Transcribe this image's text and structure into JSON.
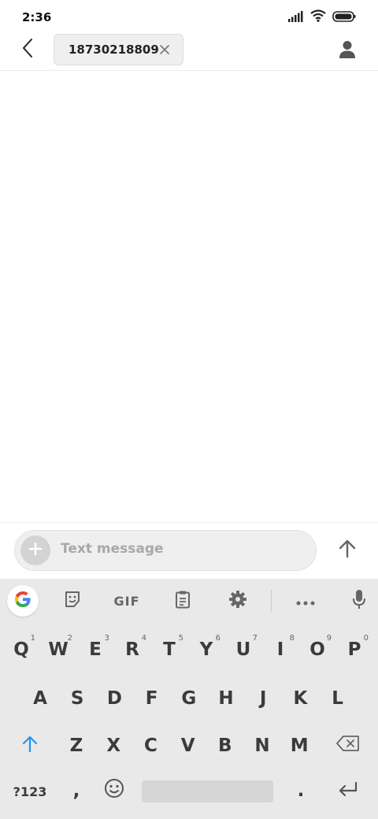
{
  "status_bar": {
    "time": "2:36",
    "icons": [
      "signal-icon",
      "wifi-icon",
      "battery-icon"
    ]
  },
  "header": {
    "back_icon": "back-arrow-icon",
    "recipient": "18730218809",
    "remove_icon": "close-icon",
    "contact_icon": "person-icon"
  },
  "compose": {
    "placeholder": "Text message",
    "attach_icon": "plus-icon",
    "send_icon": "send-arrow-icon"
  },
  "keyboard_toolbar": {
    "tools": [
      "google-icon",
      "sticker-icon",
      "gif",
      "clipboard-icon",
      "settings-icon",
      "more-icon",
      "microphone-icon"
    ],
    "gif_label": "GIF"
  },
  "keyboard": {
    "row1": [
      {
        "label": "Q",
        "hint": "1"
      },
      {
        "label": "W",
        "hint": "2"
      },
      {
        "label": "E",
        "hint": "3"
      },
      {
        "label": "R",
        "hint": "4"
      },
      {
        "label": "T",
        "hint": "5"
      },
      {
        "label": "Y",
        "hint": "6"
      },
      {
        "label": "U",
        "hint": "7"
      },
      {
        "label": "I",
        "hint": "8"
      },
      {
        "label": "O",
        "hint": "9"
      },
      {
        "label": "P",
        "hint": "0"
      }
    ],
    "row2": [
      "A",
      "S",
      "D",
      "F",
      "G",
      "H",
      "J",
      "K",
      "L"
    ],
    "row3": [
      "Z",
      "X",
      "C",
      "V",
      "B",
      "N",
      "M"
    ],
    "symbols_key": "?123",
    "comma_key": ",",
    "period_key": ".",
    "shift_icon": "shift-arrow-icon",
    "backspace_icon": "backspace-icon",
    "emoji_icon": "emoji-icon",
    "enter_icon": "enter-icon"
  },
  "colors": {
    "accent_shift": "#2196f3",
    "keyboard_bg": "#e9e9e9",
    "key_text": "#3b3b3b",
    "compose_bg": "#efefef"
  }
}
